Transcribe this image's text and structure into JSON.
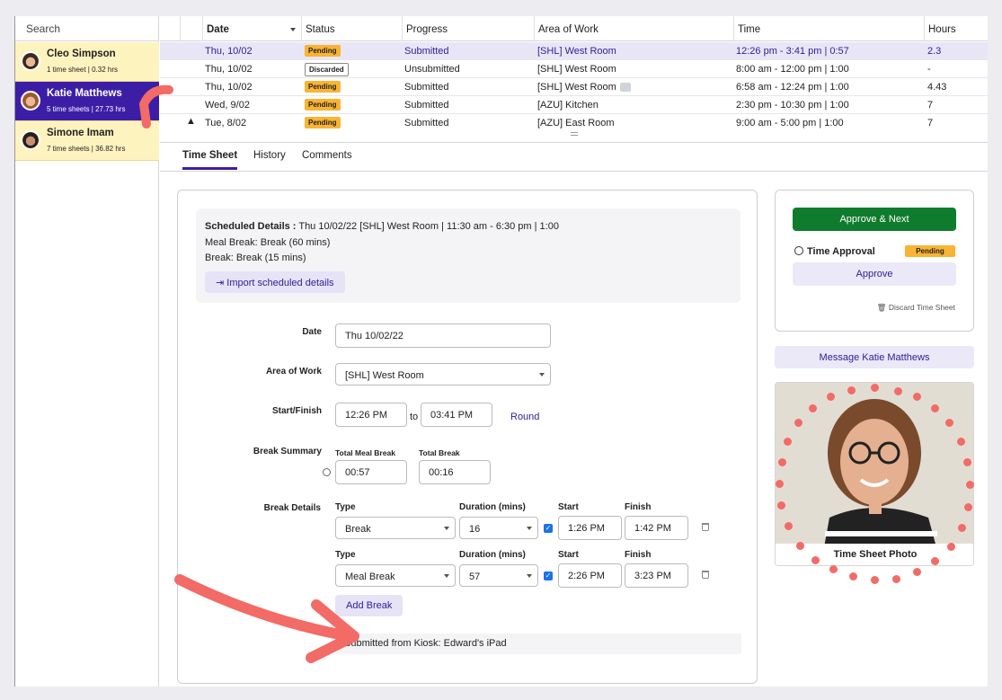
{
  "sidebar": {
    "search_placeholder": "Search",
    "people": [
      {
        "name": "Cleo Simpson",
        "stat": "1 time sheet | 0.32 hrs"
      },
      {
        "name": "Katie Matthews",
        "stat": "5 time sheets | 27.73 hrs"
      },
      {
        "name": "Simone Imam",
        "stat": "7 time sheets | 36.82 hrs"
      }
    ]
  },
  "table": {
    "headers": [
      "Date",
      "Status",
      "Progress",
      "Area of Work",
      "Time",
      "Hours"
    ],
    "rows": [
      {
        "date": "Thu, 10/02",
        "status": "Pending",
        "progress": "Submitted",
        "area": "[SHL] West Room",
        "time": "12:26 pm - 3:41 pm | 0:57",
        "hours": "2.3"
      },
      {
        "date": "Thu, 10/02",
        "status": "Discarded",
        "progress": "Unsubmitted",
        "area": "[SHL] West Room",
        "time": "8:00 am - 12:00 pm | 1:00",
        "hours": "-"
      },
      {
        "date": "Thu, 10/02",
        "status": "Pending",
        "progress": "Submitted",
        "area": "[SHL] West Room",
        "time": "6:58 am - 12:24 pm | 1:00",
        "hours": "4.43"
      },
      {
        "date": "Wed, 9/02",
        "status": "Pending",
        "progress": "Submitted",
        "area": "[AZU] Kitchen",
        "time": "2:30 pm - 10:30 pm | 1:00",
        "hours": "7"
      },
      {
        "date": "Tue, 8/02",
        "status": "Pending",
        "progress": "Submitted",
        "area": "[AZU] East Room",
        "time": "9:00 am - 5:00 pm | 1:00",
        "hours": "7"
      }
    ]
  },
  "tabs": [
    "Time Sheet",
    "History",
    "Comments"
  ],
  "form": {
    "scheduled_label": "Scheduled Details :",
    "scheduled_value": "Thu 10/02/22 [SHL] West Room | 11:30 am - 6:30 pm | 1:00",
    "meal_break": "Meal Break: Break (60 mins)",
    "break": "Break: Break (15 mins)",
    "import_button": "Import scheduled details",
    "date_label": "Date",
    "date_value": "Thu 10/02/22",
    "area_label": "Area of Work",
    "area_value": "[SHL] West Room",
    "startfinish_label": "Start/Finish",
    "start_value": "12:26 PM",
    "to_text": "to",
    "finish_value": "03:41 PM",
    "round_link": "Round",
    "break_summary_label": "Break Summary",
    "total_meal_label": "Total Meal Break",
    "total_meal_value": "00:57",
    "total_break_label": "Total Break",
    "total_break_value": "00:16",
    "break_details_label": "Break Details",
    "col_type": "Type",
    "col_duration": "Duration (mins)",
    "col_start": "Start",
    "col_finish": "Finish",
    "breaks": [
      {
        "type": "Break",
        "duration": "16",
        "start": "1:26 PM",
        "finish": "1:42 PM"
      },
      {
        "type": "Meal Break",
        "duration": "57",
        "start": "2:26 PM",
        "finish": "3:23 PM"
      }
    ],
    "add_break_button": "Add Break",
    "kiosk_note": "Submitted from Kiosk: Edward's iPad"
  },
  "approval": {
    "approve_next_button": "Approve & Next",
    "time_approval_label": "Time Approval",
    "status_badge": "Pending",
    "approve_button": "Approve",
    "discard_link": "Discard Time Sheet"
  },
  "message_button": "Message Katie Matthews",
  "photo_caption": "Time Sheet Photo",
  "colors": {
    "accent": "#3c1ea6",
    "pending": "#f8b432",
    "approve_green": "#0f7b2c",
    "annotation": "#f26b66"
  }
}
